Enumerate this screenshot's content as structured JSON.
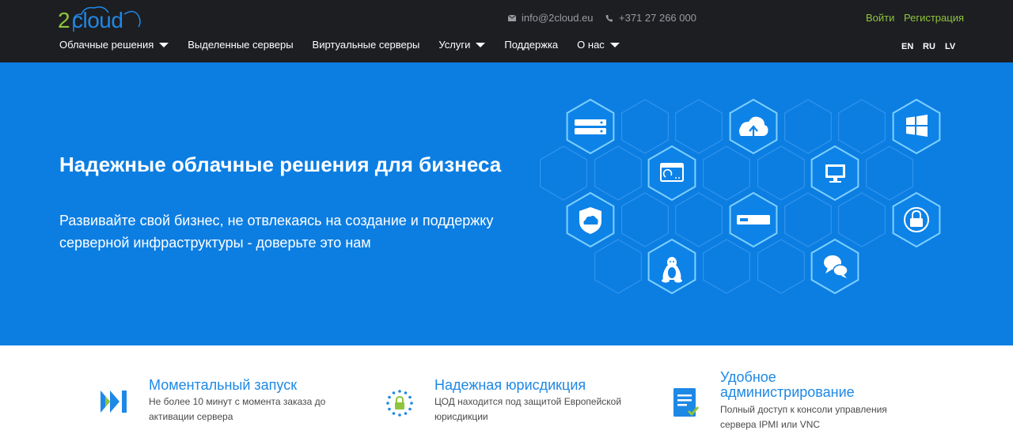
{
  "header": {
    "logo_digit": "2",
    "logo_word": "cloud",
    "email": "info@2cloud.eu",
    "phone": "+371 27 266 000",
    "login": "Войти",
    "register": "Регистрация",
    "nav": [
      {
        "label": "Облачные решения",
        "dropdown": true
      },
      {
        "label": "Выделенные серверы",
        "dropdown": false
      },
      {
        "label": "Виртуальные серверы",
        "dropdown": false
      },
      {
        "label": "Услуги",
        "dropdown": true
      },
      {
        "label": "Поддержка",
        "dropdown": false
      },
      {
        "label": "О нас",
        "dropdown": true
      }
    ],
    "languages": [
      "EN",
      "RU",
      "LV"
    ]
  },
  "hero": {
    "title": "Надежные облачные решения для бизнеса",
    "subtitle": "Развивайте свой бизнес, не отвлекаясь на создание и поддержку серверной инфраструктуры - доверьте это нам",
    "icons": [
      "server-icon",
      "cloud-upload-icon",
      "windows-icon",
      "remote-desktop-icon",
      "monitor-icon",
      "cloud-shield-icon",
      "server-slot-icon",
      "lock-icon",
      "linux-icon",
      "chat-icon"
    ]
  },
  "features": [
    {
      "icon": "fast-forward-icon",
      "title": "Моментальный запуск",
      "text": "Не более 10 минут с момента заказа до активации сервера"
    },
    {
      "icon": "eu-lock-icon",
      "title": "Надежная юрисдикция",
      "text": "ЦОД находится под защитой Европейской юрисдикции"
    },
    {
      "icon": "document-check-icon",
      "title": "Удобное администрирование",
      "text": "Полный доступ к консоли управления сервера IPMI или VNC"
    }
  ],
  "colors": {
    "topbar": "#1d1e22",
    "hero": "#0c7ee2",
    "accent_blue": "#1e88e5",
    "accent_green": "#8fc53d"
  }
}
